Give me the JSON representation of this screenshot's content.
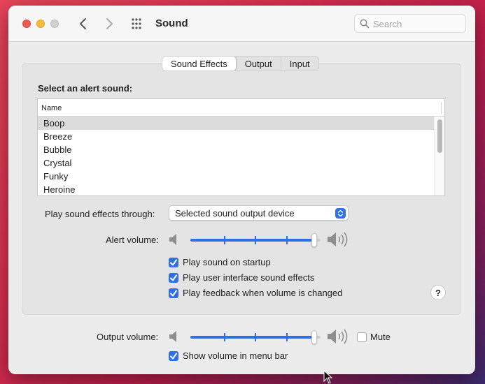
{
  "window": {
    "title": "Sound",
    "search_placeholder": "Search"
  },
  "tabs": [
    {
      "label": "Sound Effects",
      "active": true
    },
    {
      "label": "Output",
      "active": false
    },
    {
      "label": "Input",
      "active": false
    }
  ],
  "sound_effects": {
    "section_label": "Select an alert sound:",
    "list_header": "Name",
    "sounds": [
      "Boop",
      "Breeze",
      "Bubble",
      "Crystal",
      "Funky",
      "Heroine"
    ],
    "selected_index": 0,
    "play_through_label": "Play sound effects through:",
    "play_through_value": "Selected sound output device",
    "alert_volume_label": "Alert volume:",
    "alert_volume_fraction": 0.97,
    "checkboxes": [
      {
        "label": "Play sound on startup",
        "checked": true
      },
      {
        "label": "Play user interface sound effects",
        "checked": true
      },
      {
        "label": "Play feedback when volume is changed",
        "checked": true
      }
    ],
    "help_label": "?"
  },
  "footer": {
    "output_volume_label": "Output volume:",
    "output_volume_fraction": 0.97,
    "mute_label": "Mute",
    "mute_checked": false,
    "show_volume_label": "Show volume in menu bar",
    "show_volume_checked": true
  },
  "colors": {
    "accent": "#2f6fe3",
    "close": "#ee5b52",
    "minimize": "#f5bd3a",
    "zoom_disabled": "#d0d0d0"
  },
  "icons": {
    "back": "chevron-left-icon",
    "forward": "chevron-right-icon",
    "show_all": "grid-icon",
    "search": "magnifier-icon",
    "speaker_low": "speaker-low-icon",
    "speaker_high": "speaker-high-icon",
    "checkmark": "checkmark-icon",
    "stepper": "updown-chevrons-icon"
  }
}
